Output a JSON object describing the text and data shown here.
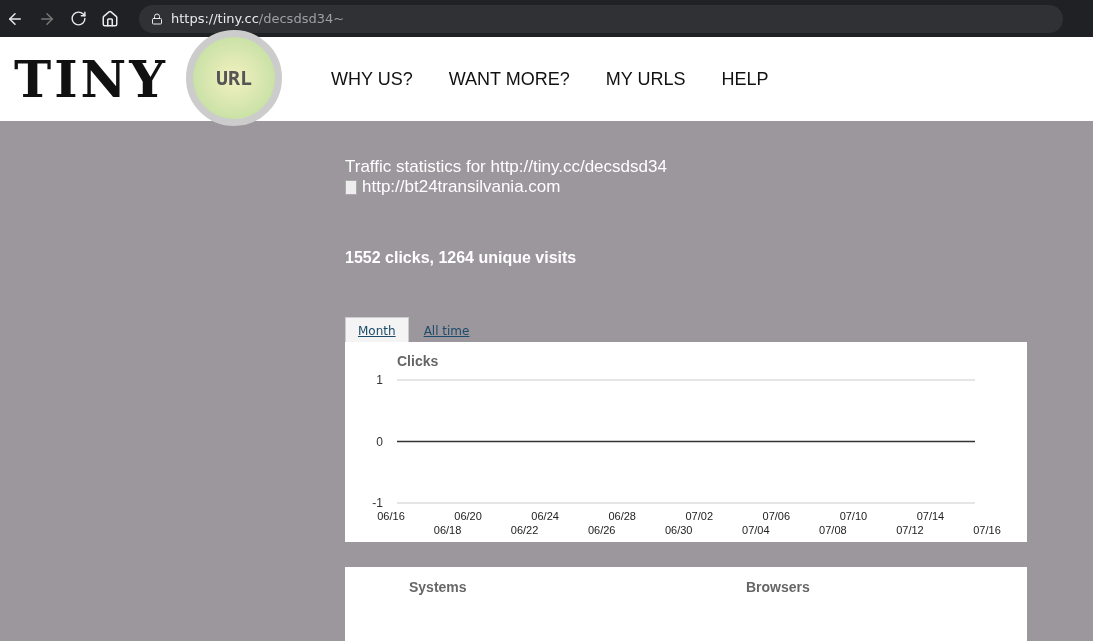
{
  "browser": {
    "url_host": "https://tiny.cc",
    "url_path": "/decsdsd34~"
  },
  "logo": {
    "word": "TINY",
    "lens_word": "URL"
  },
  "nav": [
    "WHY US?",
    "WANT MORE?",
    "MY URLS",
    "HELP"
  ],
  "title": "Traffic statistics for http://tiny.cc/decsdsd34",
  "target_url": "http://bt24transilvania.com",
  "summary": "1552 clicks, 1264 unique visits",
  "tabs": [
    {
      "label": "Month",
      "selected": true
    },
    {
      "label": "All time",
      "selected": false
    }
  ],
  "chart_data": {
    "type": "line",
    "title": "Clicks",
    "categories": [
      "06/16",
      "06/18",
      "06/20",
      "06/22",
      "06/24",
      "06/26",
      "06/28",
      "06/30",
      "07/02",
      "07/04",
      "07/06",
      "07/08",
      "07/10",
      "07/12",
      "07/14",
      "07/16"
    ],
    "ylim": [
      -1,
      1
    ],
    "yticks": [
      -1,
      0,
      1
    ],
    "series": [
      {
        "color": "#333333",
        "values": [
          0,
          0,
          0,
          0,
          0,
          0,
          0,
          0,
          0,
          0,
          0,
          0,
          0,
          0,
          0,
          0
        ]
      }
    ]
  },
  "panels": [
    "Systems",
    "Browsers"
  ]
}
